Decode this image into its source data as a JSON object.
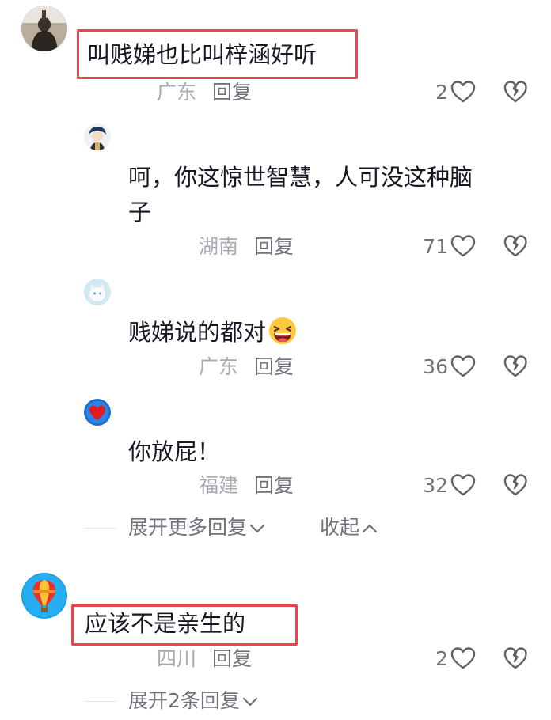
{
  "comments": [
    {
      "text": "叫贱娣也比叫梓涵好听",
      "location": "广东",
      "reply_label": "回复",
      "likes": "2",
      "replies": [
        {
          "text_line1": "呵，你这惊世智慧，人可没这种脑",
          "text_line2": "子",
          "location": "湖南",
          "reply_label": "回复",
          "likes": "71"
        },
        {
          "text": "贱娣说的都对",
          "emoji": "grinning-squint-emoji",
          "location": "广东",
          "reply_label": "回复",
          "likes": "36"
        },
        {
          "text": "你放屁！",
          "location": "福建",
          "reply_label": "回复",
          "likes": "32"
        }
      ],
      "expand_more": "展开更多回复",
      "collapse": "收起"
    },
    {
      "text": "应该不是亲生的",
      "location": "四川",
      "reply_label": "回复",
      "likes": "2",
      "expand": "展开2条回复"
    }
  ],
  "icons": {
    "like": "heart-outline-icon",
    "dislike": "broken-heart-icon",
    "expand": "chevron-down-icon",
    "collapse": "chevron-up-icon"
  },
  "colors": {
    "highlight": "#e8454f",
    "text": "#161823",
    "secondary": "#6f717b",
    "location": "#a8aab2"
  }
}
